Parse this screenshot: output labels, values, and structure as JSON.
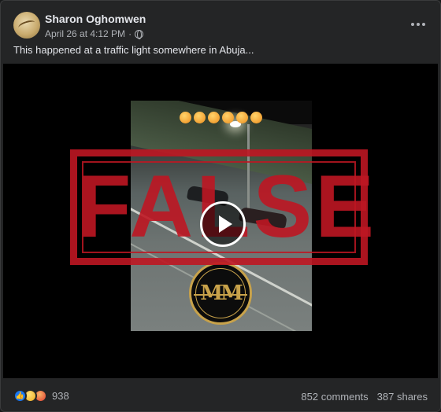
{
  "post": {
    "author": "Sharon Oghomwen",
    "timestamp": "April 26 at 4:12 PM",
    "separator": "·",
    "privacy_icon": "globe-icon",
    "caption": "This happened at a traffic light somewhere in Abuja..."
  },
  "video": {
    "stamp_text": "FALSE",
    "logo_text": "MM",
    "emoji_icon": "angry-face-emoji",
    "emoji_count": 6,
    "stamp_color": "#be1622",
    "play_icon": "play-icon"
  },
  "footer": {
    "reactions": [
      "like-icon",
      "sad-icon",
      "angry-icon"
    ],
    "reaction_count": "938",
    "comments": "852 comments",
    "shares": "387 shares"
  },
  "colors": {
    "background": "#242526",
    "text": "#e4e6eb",
    "muted": "#b0b3b8",
    "like_blue": "#1877f2"
  }
}
